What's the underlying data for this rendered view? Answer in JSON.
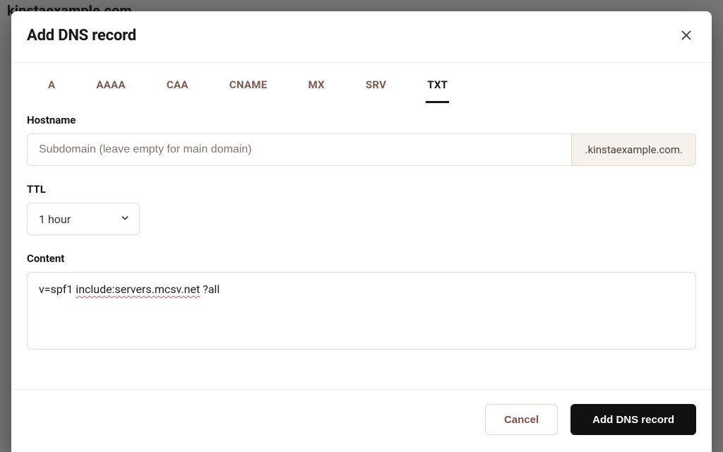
{
  "backdrop": {
    "domain_title": "kinstaexample.com"
  },
  "modal": {
    "title": "Add DNS record",
    "tabs": [
      "A",
      "AAAA",
      "CAA",
      "CNAME",
      "MX",
      "SRV",
      "TXT"
    ],
    "active_tab": "TXT",
    "hostname": {
      "label": "Hostname",
      "placeholder": "Subdomain (leave empty for main domain)",
      "value": "",
      "suffix": ".kinstaexample.com."
    },
    "ttl": {
      "label": "TTL",
      "value": "1 hour",
      "options": [
        "1 hour"
      ]
    },
    "content": {
      "label": "Content",
      "prefix": "v=spf1 ",
      "include": "include:servers.mcsv.net",
      "suffix": " ?all"
    },
    "buttons": {
      "cancel": "Cancel",
      "submit": "Add DNS record"
    }
  }
}
